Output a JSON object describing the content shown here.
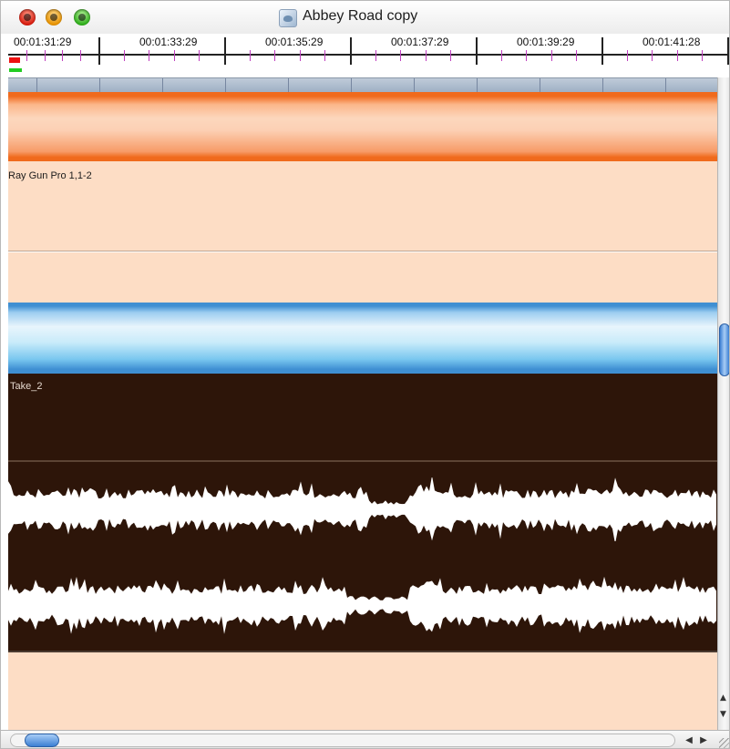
{
  "window": {
    "title": "Abbey Road copy",
    "icon": "audio-document-icon"
  },
  "ruler": {
    "timecodes": [
      "00:01:31:29",
      "00:01:33:29",
      "00:01:35:29",
      "00:01:37:29",
      "00:01:39:29",
      "00:01:41:28"
    ]
  },
  "tracks": [
    {
      "label": "Ray Gun Pro 1,1-2",
      "color": "#f06a1c"
    },
    {
      "label": "Take_2",
      "color": "#3f8fd2"
    }
  ],
  "colors": {
    "orange_track": "#f06a1c",
    "blue_track": "#3f8fd2",
    "lane_background": "#fdddc5",
    "waveform_background": "#2d1509",
    "waveform": "#ffffff"
  },
  "scrollbars": {
    "vertical_icons": [
      "arrow-up-icon",
      "arrow-down-icon"
    ],
    "horizontal_icons": [
      "arrow-left-icon",
      "arrow-right-icon"
    ]
  }
}
